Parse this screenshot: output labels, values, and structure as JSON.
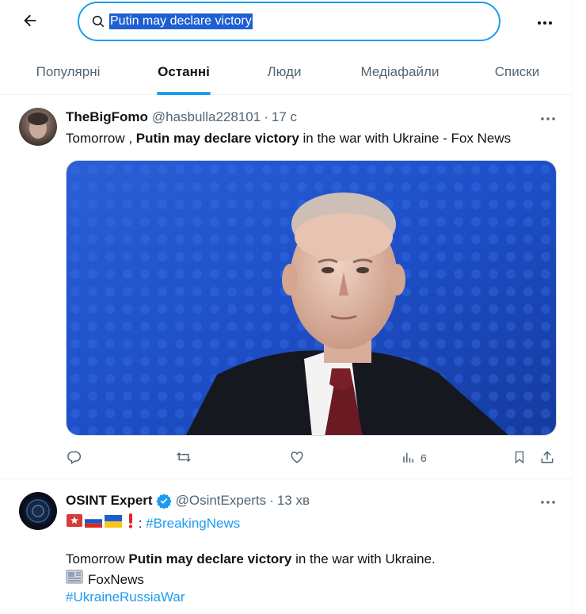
{
  "search": {
    "query": "Putin may declare victory"
  },
  "tabs": [
    {
      "label": "Популярні",
      "active": false
    },
    {
      "label": "Останні",
      "active": true
    },
    {
      "label": "Люди",
      "active": false
    },
    {
      "label": "Медіафайли",
      "active": false
    },
    {
      "label": "Списки",
      "active": false
    }
  ],
  "tweets": [
    {
      "name": "TheBigFomo",
      "handle": "@hasbulla228101",
      "dot": "·",
      "time": "17 с",
      "text_pre": "Tomorrow , ",
      "text_bold": "Putin may declare victory",
      "text_post": " in the war with Ukraine - Fox News",
      "views": "6"
    },
    {
      "name": "OSINT Expert",
      "handle": "@OsintExperts",
      "dot": "·",
      "time": "13 хв",
      "line1_sep": " : ",
      "line1_hashtag": "#BreakingNews",
      "text_pre": "Tomorrow ",
      "text_bold": "Putin may declare victory",
      "text_post": " in the war with Ukraine.",
      "source": "FoxNews",
      "hashtag2": "#UkraineRussiaWar"
    }
  ],
  "colors": {
    "accent": "#1d9bf0",
    "text": "#0f1419",
    "muted": "#536471"
  },
  "icons": [
    "back-arrow-icon",
    "search-icon",
    "more-icon",
    "reply-icon",
    "repost-icon",
    "like-icon",
    "views-icon",
    "bookmark-icon",
    "share-icon",
    "verified-icon",
    "flag-icon",
    "newspaper-icon",
    "exclamation-icon"
  ]
}
